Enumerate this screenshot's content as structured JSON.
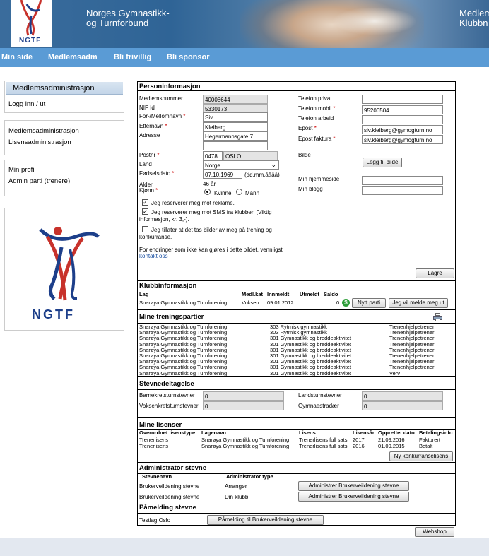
{
  "header": {
    "org_name_line1": "Norges Gymnastikk-",
    "org_name_line2": "og Turnforbund",
    "right_line1": "Medlem",
    "right_line2": "Klubbn",
    "logo_text": "NGTF"
  },
  "nav": [
    "Min side",
    "Medlemsadm",
    "Bli frivillig",
    "Bli sponsor"
  ],
  "sidebar": {
    "heading": "Medlemsadministrasjon",
    "login": "Logg inn / ut",
    "group2": [
      "Medlemsadministrasjon",
      "Lisensadministrasjon"
    ],
    "group3": [
      "Min profil",
      "Admin parti (trenere)"
    ],
    "logo_text": "NGTF"
  },
  "person": {
    "title": "Personinformasjon",
    "labels": {
      "medlemsnummer": "Medlemsnummer",
      "nif": "NIF Id",
      "fornavn": "For-/Mellomnavn",
      "etternavn": "Etternavn",
      "adresse": "Adresse",
      "postnr": "Postnr",
      "land": "Land",
      "fodselsdato": "Fødselsdato",
      "alder": "Alder",
      "kjonn": "Kjønn",
      "tlf_privat": "Telefon privat",
      "tlf_mobil": "Telefon mobil",
      "tlf_arbeid": "Telefon arbeid",
      "epost": "Epost",
      "epost_faktura": "Epost faktura",
      "bilde": "Bilde",
      "hjemmeside": "Min hjemmeside",
      "blogg": "Min blogg"
    },
    "required_mark": "*",
    "values": {
      "medlemsnummer": "40008644",
      "nif": "5330173",
      "fornavn": "Siv",
      "etternavn": "Kleiberg",
      "adresse": "Hegermannsgate 7",
      "adresse2": "",
      "postnr": "0478",
      "poststed": "OSLO",
      "land": "Norge",
      "fodselsdato": "07.10.1969",
      "date_hint": "(dd.mm.åååå)",
      "alder": "46 år",
      "tlf_privat": "",
      "tlf_mobil": "95206504",
      "tlf_arbeid": "",
      "epost": "siv.kleiberg@gymogturn.no",
      "epost_faktura": "siv.kleiberg@gymogturn.no",
      "hjemmeside": "",
      "blogg": ""
    },
    "gender_options": [
      "Kvinne",
      "Mann"
    ],
    "gender_selected": "Kvinne",
    "checkboxes": [
      {
        "label": "Jeg reserverer meg mot reklame.",
        "checked": true
      },
      {
        "label": "Jeg reserverer meg mot SMS fra klubben (Viktig informasjon, kr. 3,-).",
        "checked": true
      },
      {
        "label": "Jeg tillater at det tas bilder av meg på trening og konkurranse.",
        "checked": false
      }
    ],
    "note": "For endringer som ikke kan gjøres i dette bildet, vennligst",
    "note_link": "kontakt oss",
    "add_image_button": "Legg til bilde",
    "save_button": "Lagre"
  },
  "club": {
    "title": "Klubbinformasjon",
    "headers": [
      "Lag",
      "Medl.kat",
      "Innmeldt",
      "Utmeldt",
      "Saldo"
    ],
    "row": {
      "lag": "Snarøya Gymnastikk og Turnforening",
      "kat": "Voksen",
      "innmeldt": "09.01.2012",
      "utmeldt": "",
      "saldo": "0"
    },
    "new_party_button": "Nytt parti",
    "leave_button": "Jeg vil melde meg ut"
  },
  "training": {
    "title": "Mine treningspartier",
    "rows": [
      [
        "Snarøya Gymnastikk og Turnforening",
        "303 Rytmisk gymnastikk",
        "Trener/hjelpetrener"
      ],
      [
        "Snarøya Gymnastikk og Turnforening",
        "303 Rytmisk gymnastikk",
        "Trener/hjelpetrener"
      ],
      [
        "Snarøya Gymnastikk og Turnforening",
        "301 Gymnastikk og breddeaktivitet",
        "Trener/hjelpetrener"
      ],
      [
        "Snarøya Gymnastikk og Turnforening",
        "301 Gymnastikk og breddeaktivitet",
        "Trener/hjelpetrener"
      ],
      [
        "Snarøya Gymnastikk og Turnforening",
        "301 Gymnastikk og breddeaktivitet",
        "Trener/hjelpetrener"
      ],
      [
        "Snarøya Gymnastikk og Turnforening",
        "301 Gymnastikk og breddeaktivitet",
        "Trener/hjelpetrener"
      ],
      [
        "Snarøya Gymnastikk og Turnforening",
        "301 Gymnastikk og breddeaktivitet",
        "Trener/hjelpetrener"
      ],
      [
        "Snarøya Gymnastikk og Turnforening",
        "301 Gymnastikk og breddeaktivitet",
        "Trener/hjelpetrener"
      ],
      [
        "Snarøya Gymnastikk og Turnforening",
        "301 Gymnastikk og breddeaktivitet",
        "Verv"
      ]
    ]
  },
  "events": {
    "title": "Stevnedeltagelse",
    "labels": [
      "Barnekretsturnstevner",
      "Voksenkretsturnstevner",
      "Landsturnstevner",
      "Gymnaestradær"
    ],
    "values": [
      "0",
      "0",
      "0",
      "0"
    ]
  },
  "licenses": {
    "title": "Mine lisenser",
    "headers": [
      "Overordnet lisenstype",
      "Lagenavn",
      "Lisens",
      "Lisensår",
      "Opprettet dato",
      "Betalingsinfo"
    ],
    "rows": [
      [
        "Trenerlisens",
        "Snarøya Gymnastikk og Turnforening",
        "Trenerlisens full sats",
        "2017",
        "21.09.2016",
        "Fakturert"
      ],
      [
        "Trenerlisens",
        "Snarøya Gymnastikk og Turnforening",
        "Trenerlisens full sats",
        "2016",
        "01.09.2015",
        "Betalt"
      ]
    ],
    "new_button": "Ny konkurranselisens"
  },
  "admin": {
    "title": "Administrator stevne",
    "headers": [
      "Stevnenavn",
      "Administrator type"
    ],
    "rows": [
      {
        "name": "Brukerveildening stevne",
        "type": "Arrangør",
        "button": "Administrer Brukerveildening stevne"
      },
      {
        "name": "Brukerveildening stevne",
        "type": "Din klubb",
        "button": "Administrer Brukerveildening stevne"
      }
    ]
  },
  "signup": {
    "title": "Påmelding stevne",
    "name": "Testlag Oslo",
    "button": "Påmelding til Brukerveildening stevne"
  },
  "webshop_button": "Webshop"
}
